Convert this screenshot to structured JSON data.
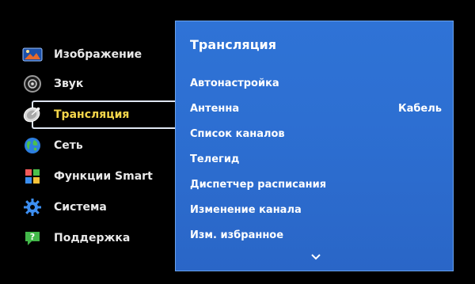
{
  "sidebar": {
    "items": [
      {
        "label": "Изображение",
        "icon": "picture-icon",
        "active": false
      },
      {
        "label": "Звук",
        "icon": "speaker-icon",
        "active": false
      },
      {
        "label": "Трансляция",
        "icon": "satellite-dish-icon",
        "active": true
      },
      {
        "label": "Сеть",
        "icon": "globe-icon",
        "active": false
      },
      {
        "label": "Функции Smart",
        "icon": "cube-icon",
        "active": false
      },
      {
        "label": "Система",
        "icon": "gear-icon",
        "active": false
      },
      {
        "label": "Поддержка",
        "icon": "help-icon",
        "active": false
      }
    ]
  },
  "panel": {
    "title": "Трансляция",
    "rows": [
      {
        "label": "Автонастройка",
        "value": ""
      },
      {
        "label": "Антенна",
        "value": "Кабель"
      },
      {
        "label": "Список каналов",
        "value": ""
      },
      {
        "label": "Телегид",
        "value": ""
      },
      {
        "label": "Диспетчер расписания",
        "value": ""
      },
      {
        "label": "Изменение канала",
        "value": ""
      },
      {
        "label": "Изм. избранное",
        "value": ""
      }
    ],
    "scroll_icon": "chevron-down-icon"
  },
  "colors": {
    "active_text": "#f4d64a",
    "panel_bg": "#2f73d6",
    "text": "#ffffff"
  }
}
